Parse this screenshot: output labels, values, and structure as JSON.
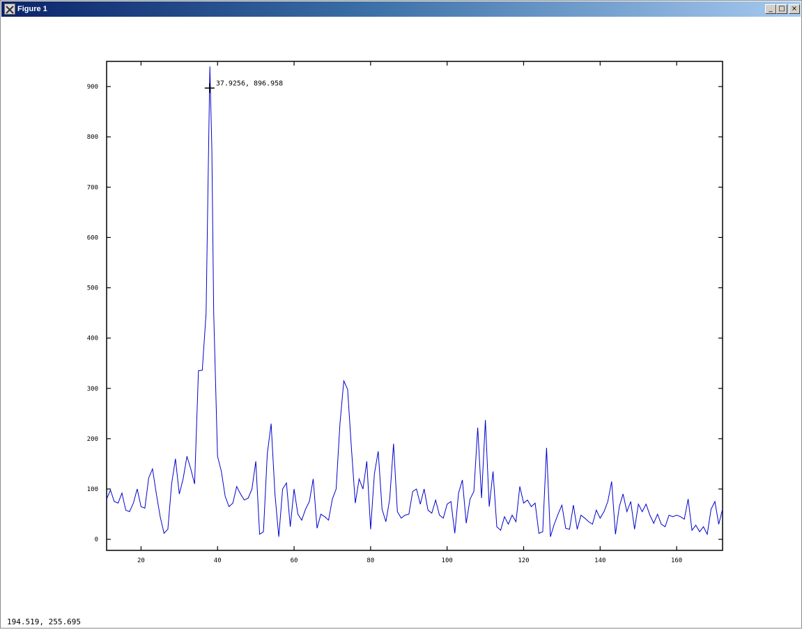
{
  "window": {
    "title": "Figure 1",
    "minimize_label": "_",
    "maximize_label": "□",
    "close_label": "×"
  },
  "status_text": "194.519,  255.695",
  "colors": {
    "line": "#0000cc",
    "axes": "#000000",
    "titlebar_start": "#0a246a",
    "titlebar_end": "#a6caf0"
  },
  "chart_data": {
    "type": "line",
    "title": "",
    "xlabel": "",
    "ylabel": "",
    "xlim": [
      11,
      172
    ],
    "ylim": [
      -22,
      950
    ],
    "xticks": [
      20,
      40,
      60,
      80,
      100,
      120,
      140,
      160
    ],
    "yticks": [
      0,
      100,
      200,
      300,
      400,
      500,
      600,
      700,
      800,
      900
    ],
    "grid": false,
    "legend": "none",
    "annotation": {
      "x": 37.9256,
      "y": 896.958,
      "label": "37.9256,  896.958"
    },
    "series": [
      {
        "x": [
          11,
          12,
          13,
          14,
          15,
          16,
          17,
          18,
          19,
          20,
          21,
          22,
          23,
          24,
          25,
          26,
          27,
          28,
          29,
          30,
          31,
          32,
          33,
          34,
          35,
          36,
          37,
          37.5,
          38,
          38.5,
          39,
          40,
          41,
          42,
          43,
          44,
          45,
          46,
          47,
          48,
          49,
          50,
          51,
          52,
          53,
          54,
          55,
          56,
          57,
          58,
          59,
          60,
          61,
          62,
          63,
          64,
          65,
          66,
          67,
          68,
          69,
          70,
          71,
          72,
          73,
          74,
          75,
          76,
          77,
          78,
          79,
          80,
          81,
          82,
          83,
          84,
          85,
          86,
          87,
          88,
          89,
          90,
          91,
          92,
          93,
          94,
          95,
          96,
          97,
          98,
          99,
          100,
          101,
          102,
          103,
          104,
          105,
          106,
          107,
          108,
          109,
          110,
          111,
          112,
          113,
          114,
          115,
          116,
          117,
          118,
          119,
          120,
          121,
          122,
          123,
          124,
          125,
          126,
          127,
          128,
          129,
          130,
          131,
          132,
          133,
          134,
          135,
          136,
          137,
          138,
          139,
          140,
          141,
          142,
          143,
          144,
          145,
          146,
          147,
          148,
          149,
          150,
          151,
          152,
          153,
          154,
          155,
          156,
          157,
          158,
          159,
          160,
          161,
          162,
          163,
          164,
          165,
          166,
          167,
          168,
          169,
          170,
          171,
          172
        ],
        "y": [
          80,
          98,
          75,
          72,
          92,
          58,
          55,
          72,
          100,
          65,
          62,
          122,
          140,
          90,
          45,
          12,
          20,
          110,
          160,
          90,
          120,
          165,
          140,
          110,
          335,
          336,
          450,
          700,
          940,
          780,
          450,
          165,
          135,
          85,
          65,
          72,
          105,
          90,
          78,
          82,
          100,
          155,
          10,
          15,
          170,
          230,
          90,
          5,
          100,
          112,
          25,
          100,
          50,
          38,
          60,
          75,
          120,
          22,
          50,
          45,
          38,
          80,
          100,
          230,
          315,
          298,
          180,
          72,
          120,
          100,
          155,
          20,
          130,
          175,
          60,
          35,
          80,
          190,
          55,
          42,
          48,
          50,
          95,
          100,
          70,
          100,
          58,
          52,
          78,
          48,
          42,
          70,
          75,
          12,
          92,
          118,
          32,
          80,
          95,
          222,
          82,
          237,
          65,
          135,
          25,
          18,
          45,
          30,
          48,
          35,
          105,
          72,
          78,
          65,
          72,
          12,
          15,
          182,
          5,
          30,
          50,
          68,
          22,
          20,
          68,
          20,
          48,
          42,
          35,
          30,
          58,
          42,
          55,
          75,
          115,
          10,
          65,
          90,
          55,
          75,
          20,
          70,
          55,
          70,
          48,
          32,
          50,
          30,
          25,
          48,
          45,
          48,
          45,
          40,
          80,
          18,
          28,
          15,
          25,
          10,
          60,
          75,
          30,
          60
        ]
      }
    ]
  }
}
